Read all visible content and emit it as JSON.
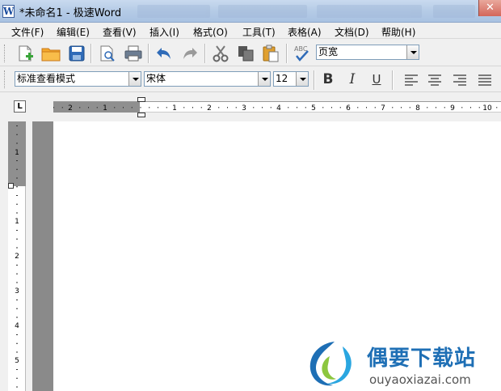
{
  "window": {
    "app_icon": "W",
    "title": "*未命名1 - 极速Word",
    "close_glyph": "✕"
  },
  "menu": [
    {
      "id": "file",
      "label": "文件(F)"
    },
    {
      "id": "edit",
      "label": "编辑(E)"
    },
    {
      "id": "view",
      "label": "查看(V)"
    },
    {
      "id": "insert",
      "label": "插入(I)"
    },
    {
      "id": "format",
      "label": "格式(O)"
    },
    {
      "id": "tools",
      "label": "工具(T)"
    },
    {
      "id": "table",
      "label": "表格(A)"
    },
    {
      "id": "document",
      "label": "文档(D)"
    },
    {
      "id": "help",
      "label": "帮助(H)"
    }
  ],
  "toolbar": {
    "icons": [
      "new-document-icon",
      "open-folder-icon",
      "save-icon",
      "print-preview-icon",
      "print-icon",
      "undo-icon",
      "redo-icon",
      "cut-icon",
      "copy-icon",
      "paste-icon",
      "spellcheck-icon"
    ],
    "spellcheck_label": "ABC",
    "zoom_value": "页宽"
  },
  "format_bar": {
    "view_mode": "标准查看模式",
    "font_name": "宋体",
    "font_size": "12",
    "bold": "B",
    "italic": "I",
    "underline": "U",
    "icons": [
      "align-left-icon",
      "align-center-icon",
      "align-right-icon",
      "justify-icon"
    ]
  },
  "ruler": {
    "tab_selector": "L",
    "h_labels": [
      "2",
      "1",
      "1",
      "2",
      "3",
      "4",
      "5",
      "6",
      "7",
      "8",
      "9",
      "10"
    ],
    "v_labels": [
      "1",
      "1",
      "2",
      "3",
      "4",
      "5"
    ]
  },
  "watermark": {
    "title": "偶要下载站",
    "url": "ouyaoxiazai.com"
  },
  "colors": {
    "accent": "#1e6fb5",
    "titlebar": "#b5cbe6",
    "margin_gray": "#8f8f8f"
  }
}
